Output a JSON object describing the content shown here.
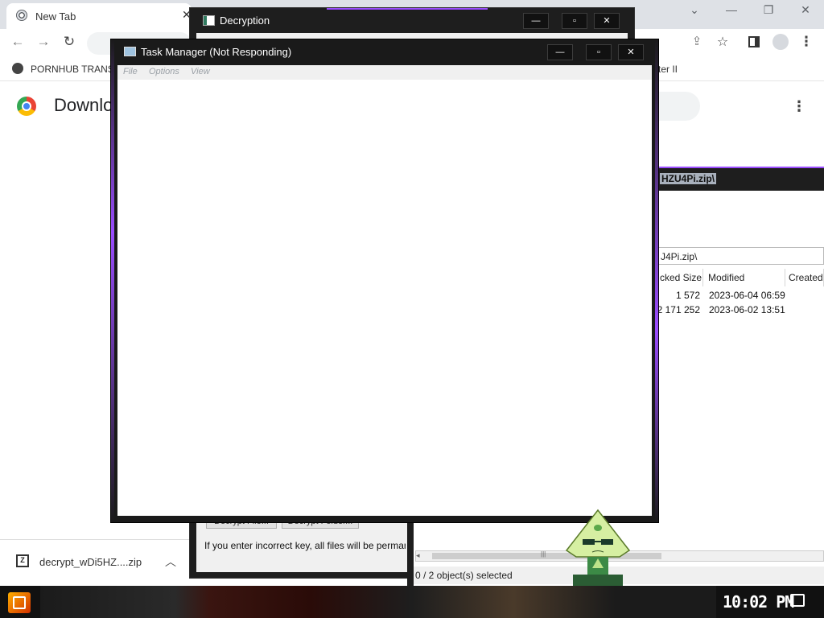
{
  "chrome": {
    "tab_title": "New Tab",
    "tab_close": "✕",
    "win_minimize": "—",
    "win_restore": "❐",
    "win_close": "✕",
    "win_chevron": "⌄",
    "bookmarks": [
      "PORNHUB TRANS",
      "ter II"
    ],
    "page_heading": "Downlo",
    "download_file": "decrypt_wDi5HZ....zip",
    "download_icon_letter": "Z"
  },
  "decryption": {
    "title": "Decryption",
    "btn_decrypt_file": "Decrypt File...",
    "btn_decrypt_folder": "Decrypt Folder...",
    "warning": "If you enter incorrect key, all files will be permanently"
  },
  "taskmgr": {
    "title": "Task Manager (Not Responding)",
    "menu": [
      "File",
      "Options",
      "View"
    ]
  },
  "archive": {
    "title_fragment": "HZU4Pi.zip\\",
    "address": "J4Pi.zip\\",
    "columns": [
      "cked Size",
      "Modified",
      "Created"
    ],
    "rows": [
      {
        "size": "1 572",
        "modified": "2023-06-04 06:59"
      },
      {
        "size": "2 171 252",
        "modified": "2023-06-02 13:51"
      }
    ],
    "status": "0 / 2 object(s) selected",
    "scroll_grip": "|||"
  },
  "taskbar": {
    "clock": "10:02 PM"
  }
}
